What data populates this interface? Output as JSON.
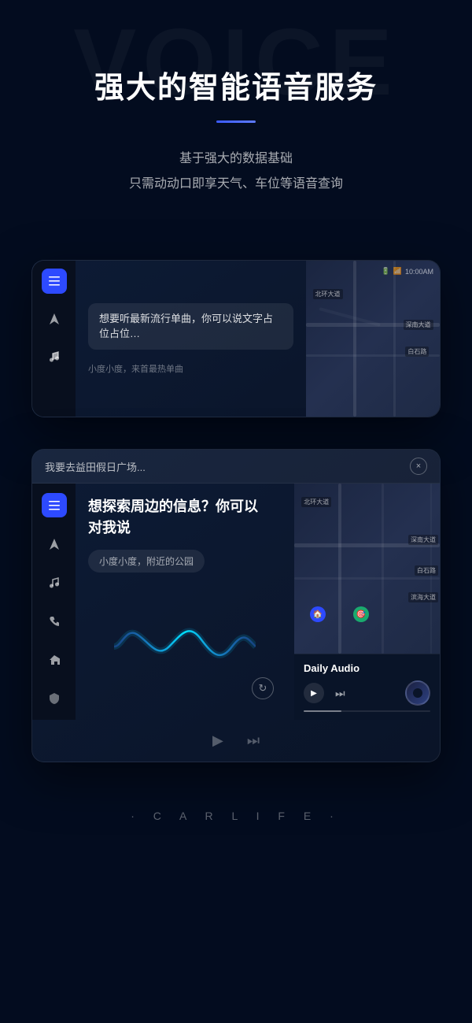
{
  "page": {
    "bg_voice_text": "VOICE",
    "main_title": "强大的智能语音服务",
    "title_underline": true,
    "subtitle_line1": "基于强大的数据基础",
    "subtitle_line2": "只需动动口即享天气、车位等语音查询",
    "carlife_label": "· C A R L I F E ·"
  },
  "screen1": {
    "status_bar": {
      "battery_icon": "🔋",
      "wifi_icon": "📶",
      "time": "10:00AM"
    },
    "chat_text": "想要听最新流行单曲，你可以说文字占位占位…",
    "sub_text": "小度小度，来首最热单曲"
  },
  "screen2": {
    "header_text": "我要去益田假日广场...",
    "close_icon": "×",
    "voice_title_line1": "想探索周边的信息？你可以",
    "voice_title_line2": "对我说",
    "voice_suggestion": "小度小度，附近的公园",
    "map_labels": [
      "北环大道",
      "深南大道",
      "白石路",
      "滨海大道"
    ],
    "audio_title": "Daily Audio",
    "play_icon": "▶",
    "next_icon": "⏭",
    "refresh_icon": "↻"
  },
  "sidebar": {
    "icon1": "☰",
    "icon2": "▲",
    "icon3": "♪",
    "icon4": "📞",
    "icon5": "⬡",
    "icon6": "🛡"
  }
}
